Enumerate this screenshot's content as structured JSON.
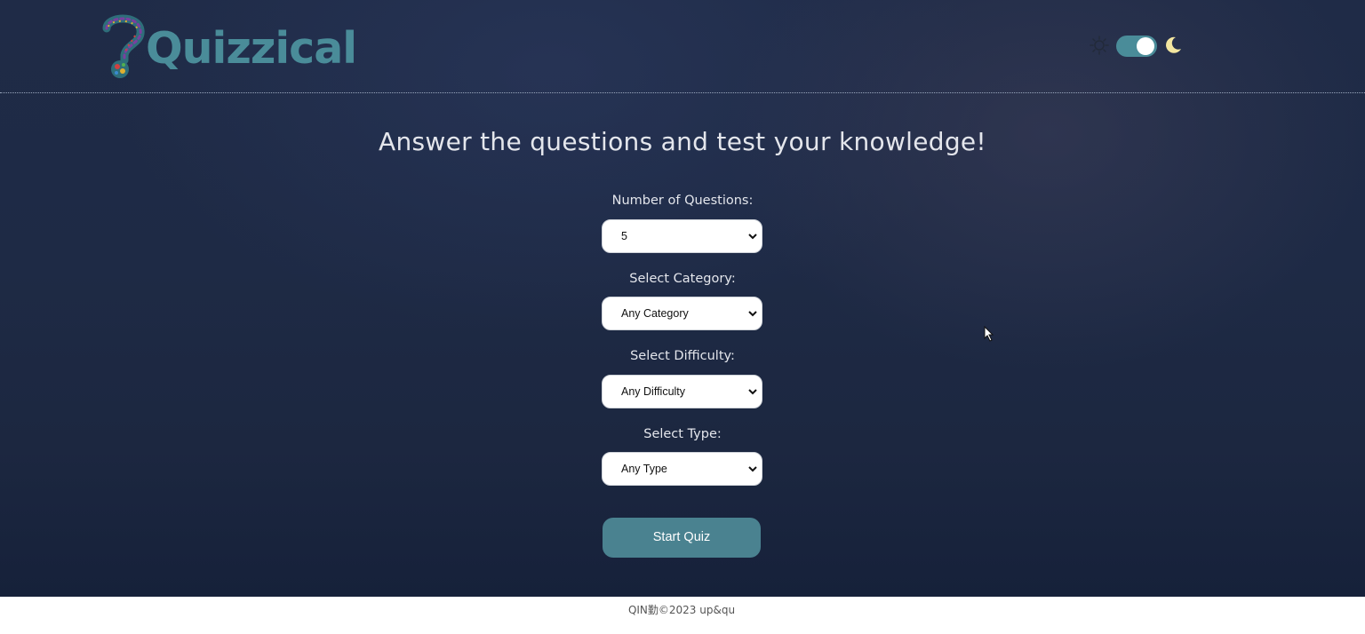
{
  "header": {
    "logo_text": "Quizzical",
    "theme_toggle": {
      "left_icon": "sun-icon",
      "right_icon": "moon-icon",
      "state": "dark"
    }
  },
  "main": {
    "headline": "Answer the questions and test your knowledge!",
    "fields": [
      {
        "label": "Number of Questions:",
        "value": "5"
      },
      {
        "label": "Select Category:",
        "value": "Any Category"
      },
      {
        "label": "Select Difficulty:",
        "value": "Any Difficulty"
      },
      {
        "label": "Select Type:",
        "value": "Any Type"
      }
    ],
    "start_label": "Start Quiz"
  },
  "footer": {
    "text": "QIN勤©2023 up&qu"
  },
  "colors": {
    "accent": "#4a8c99",
    "button": "#4a8290",
    "background": "#1e2a45",
    "text": "#e4e6ec"
  }
}
